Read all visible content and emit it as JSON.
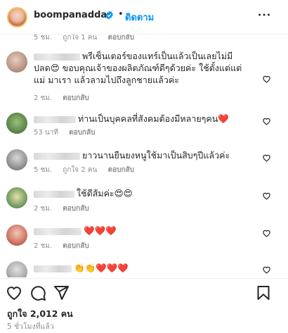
{
  "header": {
    "username": "boompanadda",
    "follow_label": "ติดตาม",
    "dot": "•"
  },
  "top_meta": {
    "time": "5 ชม.",
    "likes": "ถูกใจ 1 คน",
    "reply": "ตอบกลับ"
  },
  "comments": [
    {
      "text": "พรีเซ็นเตอร์ของแทร์เป็นแล้วเป็นเลยไม่มีปลด😍 ขอบคุณเจ้าของผลิตภัณฑ์ดีๆด้วยค่ะ ใช้ตั้งแต่แต่แม่ มาเรา แล้วลามไปถึงลูกชายแล้วค่ะ",
      "time": "2 ชม.",
      "likes": "",
      "reply": "ตอบกลับ"
    },
    {
      "text": "ท่านเป็นบุคคลที่สังคมต้องมีหลายๆคน❤️",
      "time": "53 นาที",
      "likes": "",
      "reply": "ตอบกลับ"
    },
    {
      "text": "ยาวนานยืนยงหนูใช้มาเป็นสิบๆปีแล้วค่ะ",
      "time": "5 ชม.",
      "likes": "ถูกใจ 2 คน",
      "reply": "ตอบกลับ"
    },
    {
      "text": "ใช้ดีส้มค่ะ😍😍",
      "time": "2 ชม.",
      "likes": "",
      "reply": "ตอบกลับ"
    },
    {
      "text": "❤️❤️❤️",
      "time": "2 ชม.",
      "likes": "",
      "reply": "ตอบกลับ"
    },
    {
      "text": "👏👏❤️❤️❤️",
      "time": "",
      "likes": "",
      "reply": ""
    }
  ],
  "footer": {
    "likes_count": "ถูกใจ 2,012 คน",
    "posted": "5 ชั่วโมงที่แล้ว"
  },
  "colors": {
    "accent": "#0095f6",
    "verified": "#0095f6",
    "text": "#262626",
    "muted": "#8e8e8e",
    "border": "#efefef"
  },
  "icons": {
    "more": "more-horizontal-icon",
    "like": "heart-outline-icon",
    "comment": "comment-bubble-icon",
    "share": "paper-plane-icon",
    "save": "bookmark-icon"
  }
}
